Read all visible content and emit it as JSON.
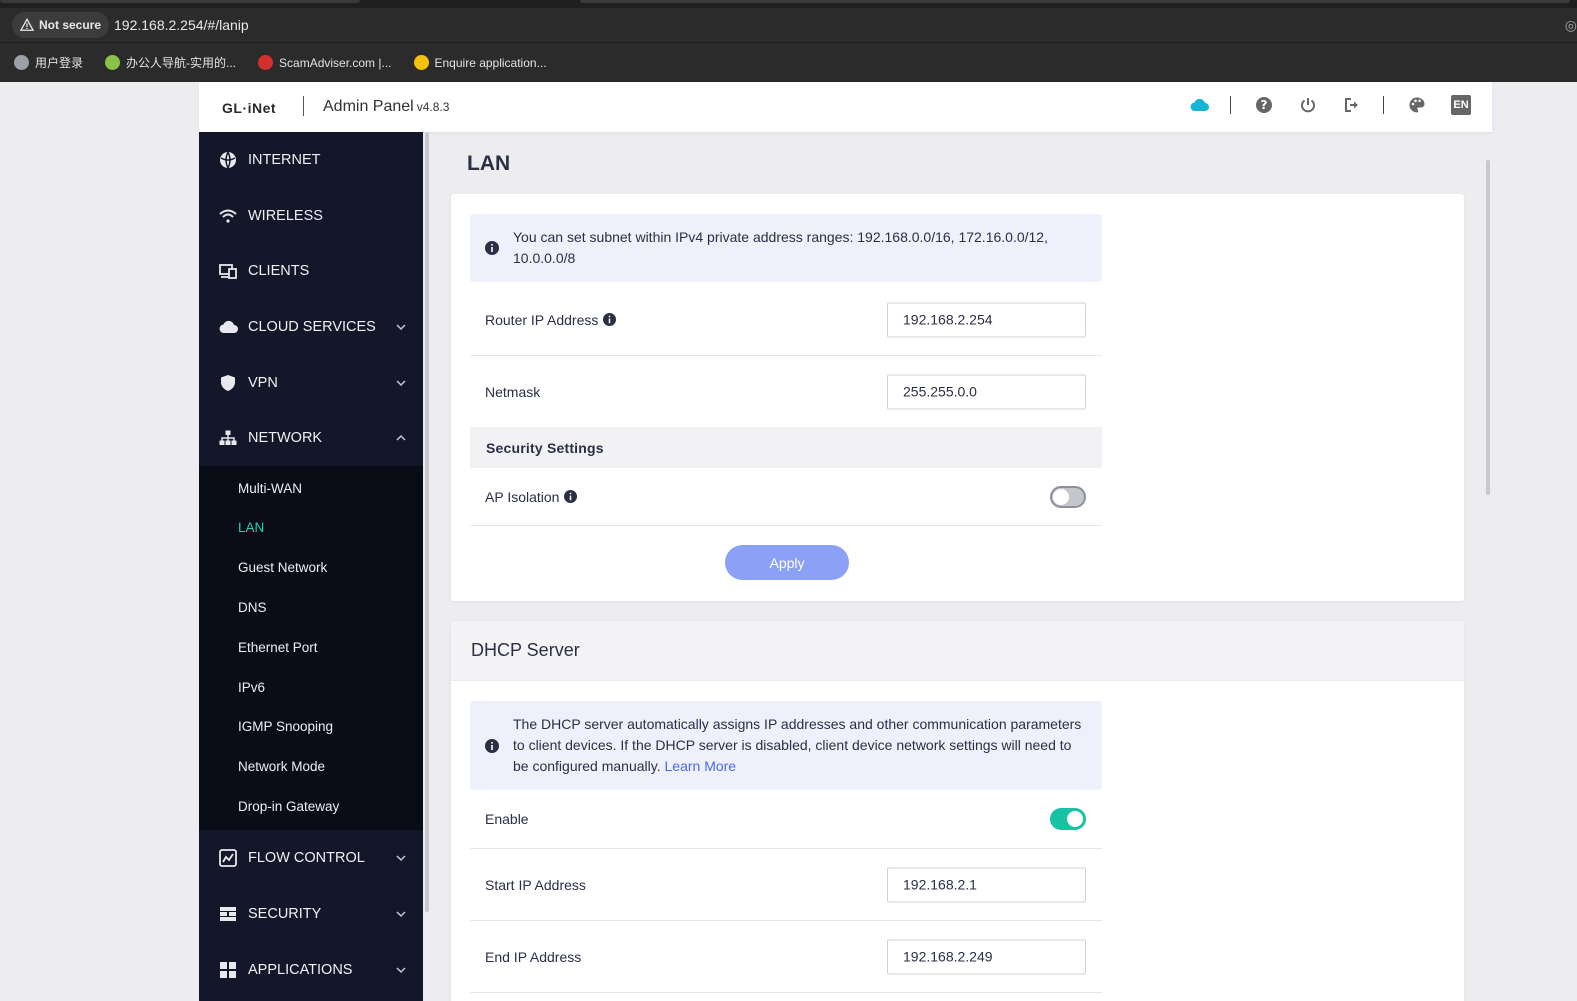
{
  "browser": {
    "not_secure_label": "Not secure",
    "url": "192.168.2.254/#/lanip",
    "bookmarks": [
      {
        "label": "用户登录",
        "icon": "globe-icon",
        "color": "#9aa0a6"
      },
      {
        "label": "办公人导航-实用的...",
        "icon": "site-icon",
        "color": "#8bc34a"
      },
      {
        "label": "ScamAdviser.com |...",
        "icon": "scamadviser-icon",
        "color": "#d32f2f"
      },
      {
        "label": "Enquire application...",
        "icon": "enquire-icon",
        "color": "#f4c20d"
      }
    ]
  },
  "header": {
    "logo": "GL·iNet",
    "title": "Admin Panel",
    "version": "v4.8.3",
    "lang": "EN",
    "icons": [
      "cloud-icon",
      "help-icon",
      "power-icon",
      "logout-icon",
      "palette-icon",
      "language-icon"
    ],
    "cloud_color": "#18b4d6"
  },
  "sidebar": {
    "items": [
      {
        "label": "INTERNET",
        "icon": "internet-icon"
      },
      {
        "label": "WIRELESS",
        "icon": "wifi-icon"
      },
      {
        "label": "CLIENTS",
        "icon": "clients-icon"
      },
      {
        "label": "CLOUD SERVICES",
        "icon": "cloud-icon",
        "chevron": "down"
      },
      {
        "label": "VPN",
        "icon": "shield-icon",
        "chevron": "down"
      },
      {
        "label": "NETWORK",
        "icon": "network-icon",
        "chevron": "up"
      }
    ],
    "network_sub": [
      "Multi-WAN",
      "LAN",
      "Guest Network",
      "DNS",
      "Ethernet Port",
      "IPv6",
      "IGMP Snooping",
      "Network Mode",
      "Drop-in Gateway"
    ],
    "active_sub": "LAN",
    "items_after": [
      {
        "label": "FLOW CONTROL",
        "icon": "flow-control-icon",
        "chevron": "down"
      },
      {
        "label": "SECURITY",
        "icon": "firewall-icon",
        "chevron": "down"
      },
      {
        "label": "APPLICATIONS",
        "icon": "apps-icon",
        "chevron": "down"
      }
    ],
    "active_color": "#1fd1b3"
  },
  "lan": {
    "title": "LAN",
    "info": "You can set subnet within IPv4 private address ranges: 192.168.0.0/16, 172.16.0.0/12, 10.0.0.0/8",
    "router_ip_label": "Router IP Address",
    "router_ip_value": "192.168.2.254",
    "netmask_label": "Netmask",
    "netmask_value": "255.255.0.0",
    "security_heading": "Security Settings",
    "ap_isolation_label": "AP Isolation",
    "ap_isolation_enabled": false,
    "apply_label": "Apply"
  },
  "dhcp": {
    "title": "DHCP Server",
    "info": "The DHCP server automatically assigns IP addresses and other communication parameters to client devices. If the DHCP server is disabled, client device network settings will need to be configured manually.",
    "learn_more": "Learn More",
    "enable_label": "Enable",
    "enabled": true,
    "start_ip_label": "Start IP Address",
    "start_ip_value": "192.168.2.1",
    "end_ip_label": "End IP Address",
    "end_ip_value": "192.168.2.249"
  }
}
